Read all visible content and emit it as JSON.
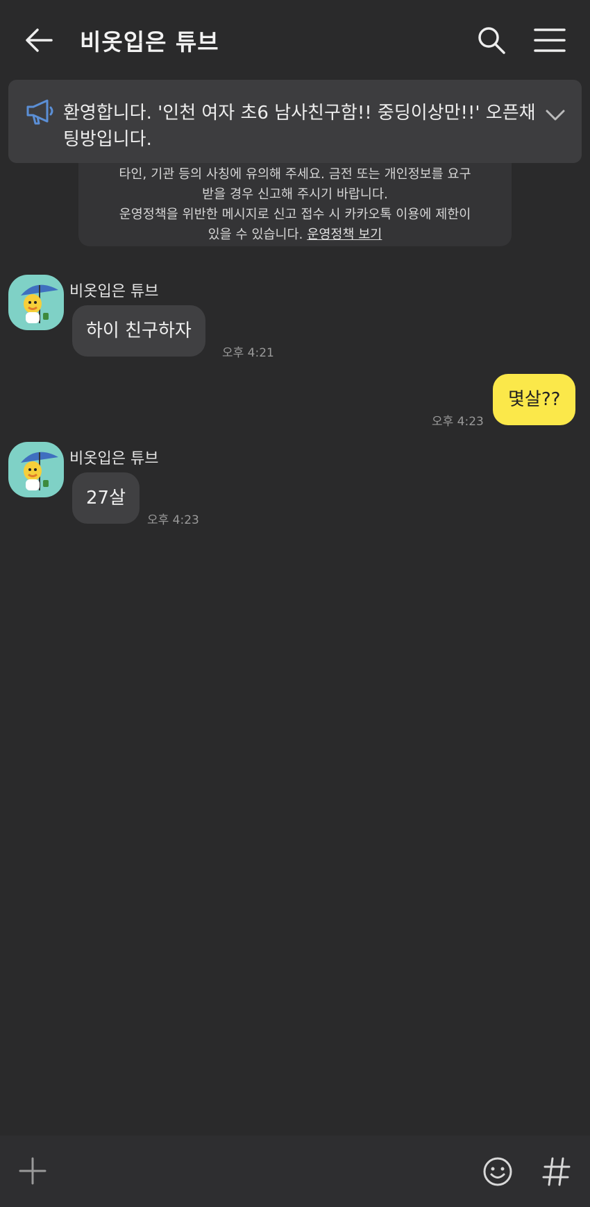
{
  "header": {
    "title": "비옷입은 튜브",
    "back_icon": "arrow-left-icon",
    "search_icon": "search-icon",
    "menu_icon": "menu-icon"
  },
  "notice": {
    "icon": "megaphone-icon",
    "text": "환영합니다. '인천 여자 초6 남사친구함!! 중딩이상만!!' 오픈채팅방입니다.",
    "toggle_icon": "chevron-down-icon"
  },
  "policy": {
    "line1": "타인, 기관 등의 사칭에 유의해 주세요. 금전 또는 개인정보를 요구",
    "line2": "받을 경우 신고해 주시기 바랍니다.",
    "line3": "운영정책을 위반한 메시지로 신고 접수 시 카카오톡 이용에 제한이",
    "line4_prefix": "있을 수 있습니다.",
    "link": "운영정책 보기"
  },
  "messages": [
    {
      "direction": "in",
      "sender": "비옷입은 튜브",
      "text": "하이 친구하자",
      "time": "오후 4:21"
    },
    {
      "direction": "out",
      "text": "몇살??",
      "time": "오후 4:23"
    },
    {
      "direction": "in",
      "sender": "비옷입은 튜브",
      "text": "27살",
      "time": "오후 4:23"
    }
  ],
  "input_bar": {
    "plus_icon": "plus-icon",
    "emoji_icon": "emoji-icon",
    "hash_icon": "hashtag-icon"
  },
  "colors": {
    "background": "#2a2a2b",
    "notice_bg": "#3d3d3f",
    "bubble_in": "#404042",
    "bubble_out": "#fbe84a",
    "accent_icon": "#5b8fd6"
  }
}
